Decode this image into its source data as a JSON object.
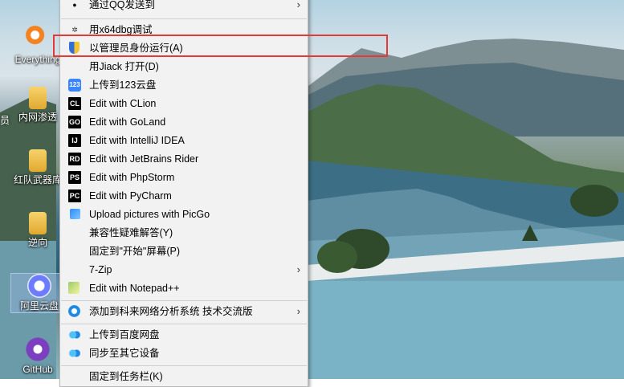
{
  "desktop": {
    "icons": [
      {
        "label": "Everything",
        "icon": "everything-icon"
      },
      {
        "label": "内网渗透",
        "icon": "folder-icon"
      },
      {
        "label": "红队武器库",
        "icon": "folder-icon"
      },
      {
        "label": "逆向",
        "icon": "folder-icon"
      },
      {
        "label": "阿里云盘",
        "icon": "aliyun-drive-icon"
      },
      {
        "label": "GitHub",
        "icon": "github-icon"
      }
    ],
    "edge_fragment": "员"
  },
  "context_menu": {
    "items": [
      {
        "label": "通过QQ发送到",
        "icon": "qq-icon",
        "submenu": true
      },
      {
        "label": "用x64dbg调试",
        "icon": "x64dbg-icon"
      },
      {
        "label": "以管理员身份运行(A)",
        "icon": "uac-shield-icon"
      },
      {
        "label": "用Jiack  打开(D)",
        "icon": ""
      },
      {
        "label": "上传到123云盘",
        "icon": "123pan-icon",
        "icon_text": "123"
      },
      {
        "label": "Edit with CLion",
        "icon": "clion-icon",
        "icon_text": "CL"
      },
      {
        "label": "Edit with GoLand",
        "icon": "goland-icon",
        "icon_text": "GO"
      },
      {
        "label": "Edit with IntelliJ IDEA",
        "icon": "intellij-icon",
        "icon_text": "IJ"
      },
      {
        "label": "Edit with JetBrains Rider",
        "icon": "rider-icon",
        "icon_text": "RD"
      },
      {
        "label": "Edit with PhpStorm",
        "icon": "phpstorm-icon",
        "icon_text": "PS"
      },
      {
        "label": "Edit with PyCharm",
        "icon": "pycharm-icon",
        "icon_text": "PC"
      },
      {
        "label": "Upload pictures with PicGo",
        "icon": "picgo-icon"
      },
      {
        "label": "兼容性疑难解答(Y)",
        "icon": ""
      },
      {
        "label": "固定到\"开始\"屏幕(P)",
        "icon": ""
      },
      {
        "label": "7-Zip",
        "icon": "",
        "submenu": true
      },
      {
        "label": "Edit with Notepad++",
        "icon": "notepadpp-icon"
      },
      {
        "label": "添加到科来网络分析系统 技术交流版",
        "icon": "colasoft-icon",
        "submenu": true
      },
      {
        "label": "上传到百度网盘",
        "icon": "baidu-netdisk-icon"
      },
      {
        "label": "同步至其它设备",
        "icon": "baidu-sync-icon"
      },
      {
        "label": "固定到任务栏(K)",
        "icon": ""
      }
    ],
    "highlighted_item": "以管理员身份运行(A)",
    "submenu_arrow": "›"
  },
  "colors": {
    "menu_bg": "#f2f2f2",
    "highlight_border": "#e53935",
    "jetbrains_badge": "#000000"
  }
}
